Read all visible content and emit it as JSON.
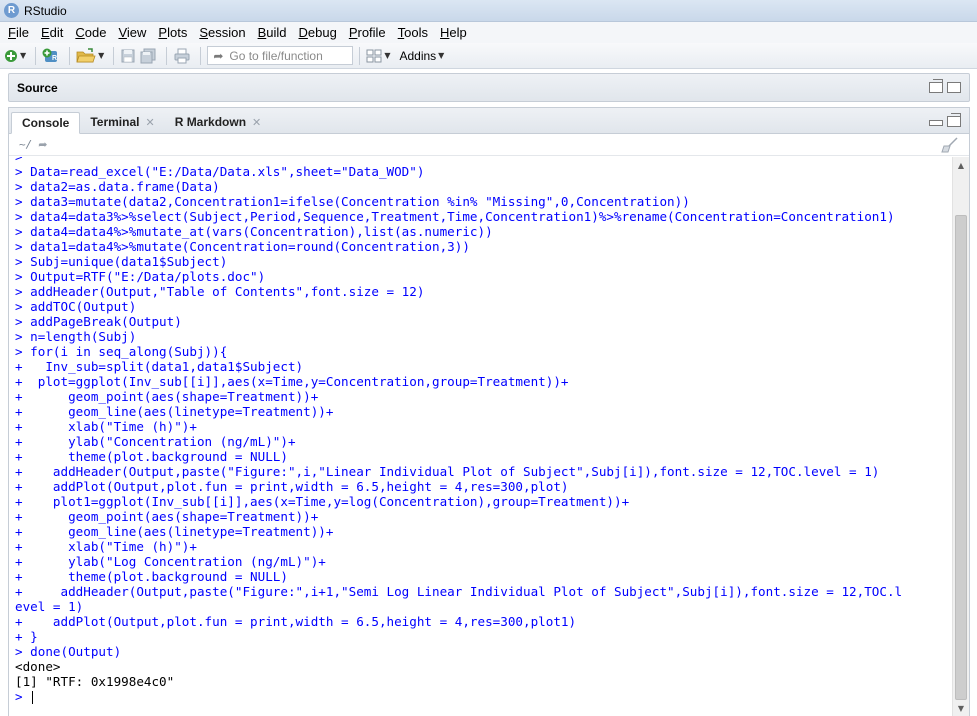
{
  "window": {
    "title": "RStudio",
    "logo_letter": "R"
  },
  "menu": [
    {
      "key": "F",
      "rest": "ile"
    },
    {
      "key": "E",
      "rest": "dit"
    },
    {
      "key": "C",
      "rest": "ode"
    },
    {
      "key": "V",
      "rest": "iew"
    },
    {
      "key": "P",
      "rest": "lots"
    },
    {
      "key": "S",
      "rest": "ession"
    },
    {
      "key": "B",
      "rest": "uild"
    },
    {
      "key": "D",
      "rest": "ebug"
    },
    {
      "key": "P",
      "rest": "rofile"
    },
    {
      "key": "T",
      "rest": "ools"
    },
    {
      "key": "H",
      "rest": "elp"
    }
  ],
  "toolbar": {
    "goto_placeholder": "Go to file/function",
    "addins_label": "Addins"
  },
  "source_pane": {
    "title": "Source"
  },
  "console_pane": {
    "tabs": [
      {
        "label": "Console",
        "closable": false
      },
      {
        "label": "Terminal",
        "closable": true
      },
      {
        "label": "R Markdown",
        "closable": true
      }
    ],
    "path": "~/",
    "lines": [
      {
        "text": ">   ",
        "kind": "in"
      },
      {
        "text": "> Data=read_excel(\"E:/Data/Data.xls\",sheet=\"Data_WOD\")",
        "kind": "in"
      },
      {
        "text": "> data2=as.data.frame(Data)",
        "kind": "in"
      },
      {
        "text": "> data3=mutate(data2,Concentration1=ifelse(Concentration %in% \"Missing\",0,Concentration))",
        "kind": "in"
      },
      {
        "text": "> data4=data3%>%select(Subject,Period,Sequence,Treatment,Time,Concentration1)%>%rename(Concentration=Concentration1)",
        "kind": "in"
      },
      {
        "text": "> data4=data4%>%mutate_at(vars(Concentration),list(as.numeric))",
        "kind": "in"
      },
      {
        "text": "> data1=data4%>%mutate(Concentration=round(Concentration,3))",
        "kind": "in"
      },
      {
        "text": "> Subj=unique(data1$Subject)",
        "kind": "in"
      },
      {
        "text": "> Output=RTF(\"E:/Data/plots.doc\")",
        "kind": "in"
      },
      {
        "text": "> addHeader(Output,\"Table of Contents\",font.size = 12)",
        "kind": "in"
      },
      {
        "text": "> addTOC(Output)",
        "kind": "in"
      },
      {
        "text": "> addPageBreak(Output)",
        "kind": "in"
      },
      {
        "text": "> n=length(Subj)",
        "kind": "in"
      },
      {
        "text": "> for(i in seq_along(Subj)){",
        "kind": "in"
      },
      {
        "text": "+   Inv_sub=split(data1,data1$Subject)",
        "kind": "in"
      },
      {
        "text": "+  plot=ggplot(Inv_sub[[i]],aes(x=Time,y=Concentration,group=Treatment))+",
        "kind": "in"
      },
      {
        "text": "+      geom_point(aes(shape=Treatment))+",
        "kind": "in"
      },
      {
        "text": "+      geom_line(aes(linetype=Treatment))+",
        "kind": "in"
      },
      {
        "text": "+      xlab(\"Time (h)\")+",
        "kind": "in"
      },
      {
        "text": "+      ylab(\"Concentration (ng/mL)\")+",
        "kind": "in"
      },
      {
        "text": "+      theme(plot.background = NULL)",
        "kind": "in"
      },
      {
        "text": "+    addHeader(Output,paste(\"Figure:\",i,\"Linear Individual Plot of Subject\",Subj[i]),font.size = 12,TOC.level = 1)",
        "kind": "in"
      },
      {
        "text": "+    addPlot(Output,plot.fun = print,width = 6.5,height = 4,res=300,plot)",
        "kind": "in"
      },
      {
        "text": "+    plot1=ggplot(Inv_sub[[i]],aes(x=Time,y=log(Concentration),group=Treatment))+",
        "kind": "in"
      },
      {
        "text": "+      geom_point(aes(shape=Treatment))+",
        "kind": "in"
      },
      {
        "text": "+      geom_line(aes(linetype=Treatment))+",
        "kind": "in"
      },
      {
        "text": "+      xlab(\"Time (h)\")+",
        "kind": "in"
      },
      {
        "text": "+      ylab(\"Log Concentration (ng/mL)\")+",
        "kind": "in"
      },
      {
        "text": "+      theme(plot.background = NULL)",
        "kind": "in"
      },
      {
        "text": "+     addHeader(Output,paste(\"Figure:\",i+1,\"Semi Log Linear Individual Plot of Subject\",Subj[i]),font.size = 12,TOC.l",
        "kind": "in"
      },
      {
        "text": "evel = 1)",
        "kind": "in"
      },
      {
        "text": "+    addPlot(Output,plot.fun = print,width = 6.5,height = 4,res=300,plot1)",
        "kind": "in"
      },
      {
        "text": "+ }",
        "kind": "in"
      },
      {
        "text": "> done(Output)",
        "kind": "in"
      },
      {
        "text": "<done>",
        "kind": "out"
      },
      {
        "text": "[1] \"RTF: 0x1998e4c0\"",
        "kind": "out"
      },
      {
        "text": "> ",
        "kind": "prompt"
      }
    ]
  },
  "colors": {
    "input": "#0000ff",
    "output": "#000000",
    "panel_bg": "#e1e6ec"
  }
}
